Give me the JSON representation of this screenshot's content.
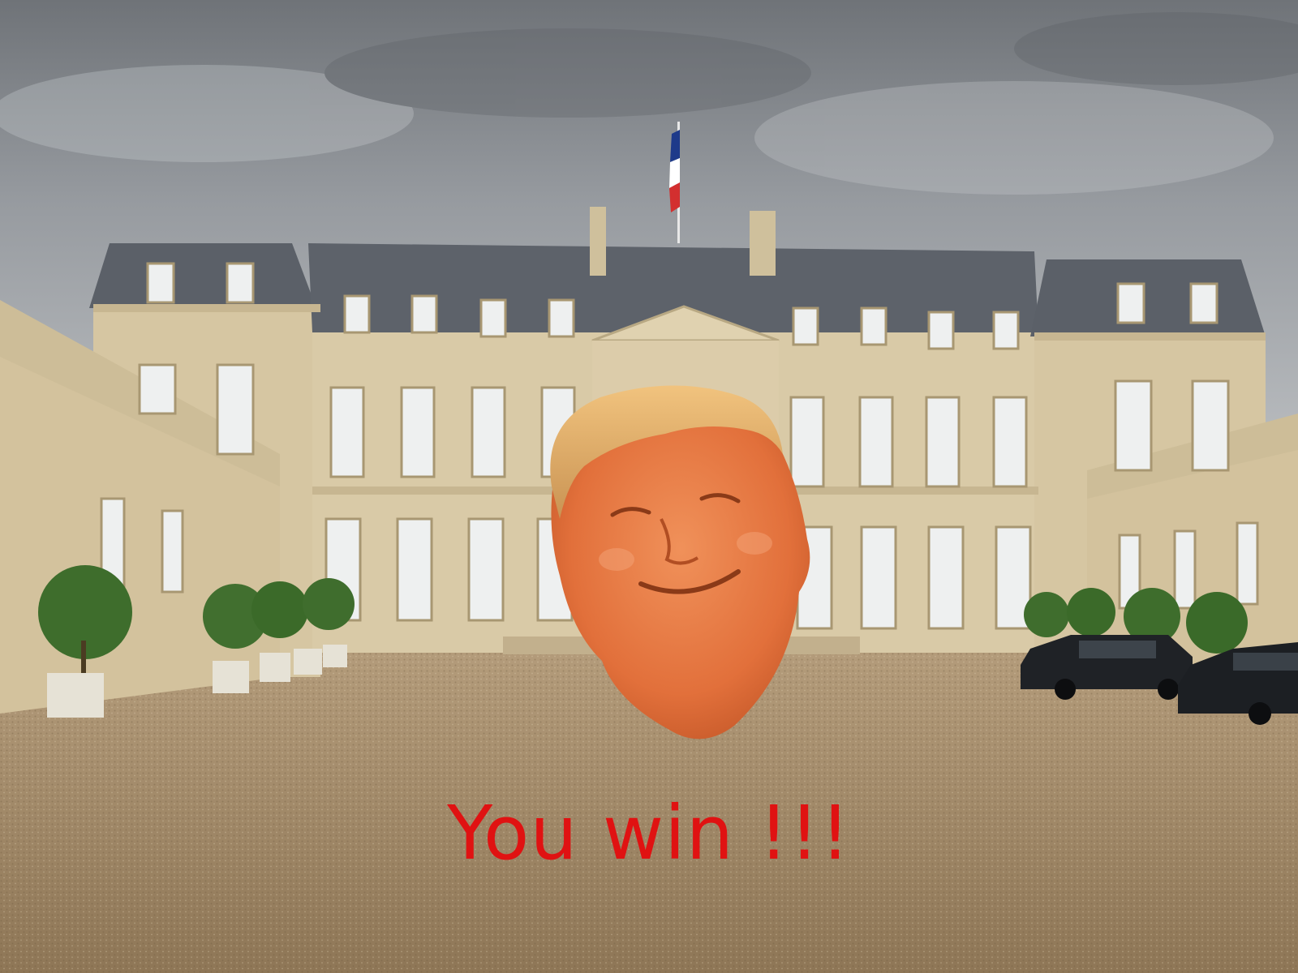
{
  "game": {
    "result_message": "You win !!!",
    "result_color": "#e01212"
  },
  "scene": {
    "sky_color": "#8d9196",
    "facade_color": "#d8c8a4",
    "roof_color": "#5b6068",
    "gravel_color": "#a7906f",
    "flag_colors": [
      "#1e3a8a",
      "#ffffff",
      "#d32f2f"
    ],
    "character_icon": "smiling-face-icon",
    "objects": [
      "palace-building",
      "french-flag-icon",
      "potted-tree-icon",
      "parked-car-icon"
    ]
  }
}
